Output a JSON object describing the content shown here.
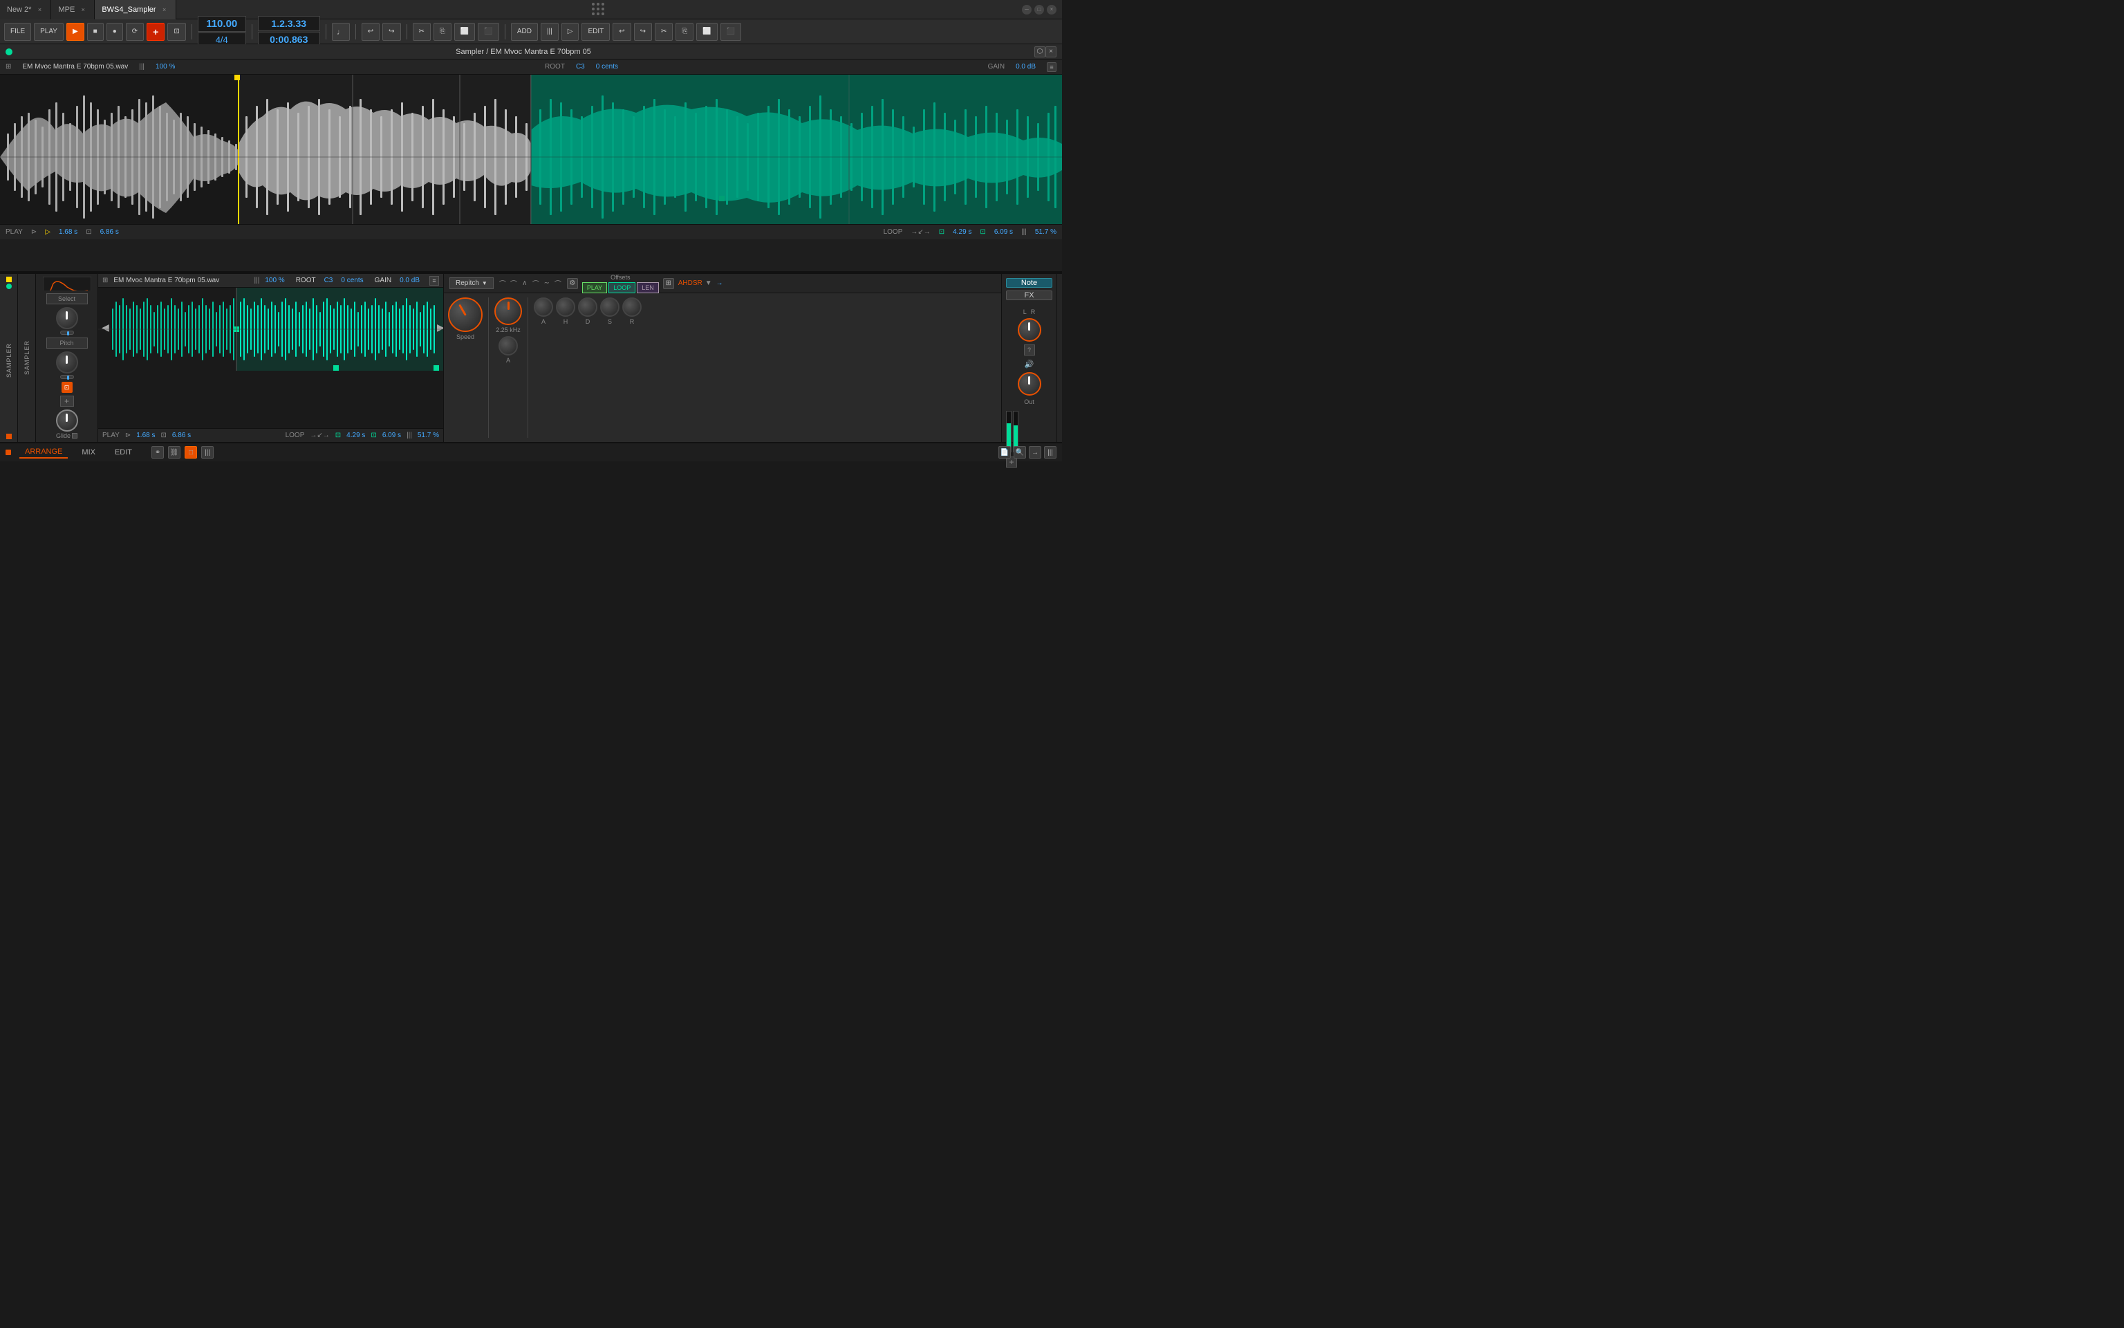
{
  "titlebar": {
    "tabs": [
      {
        "label": "New 2*",
        "active": false,
        "closeable": true
      },
      {
        "label": "MPE",
        "active": false,
        "closeable": true
      },
      {
        "label": "BWS4_Sampler",
        "active": true,
        "closeable": true
      }
    ],
    "title": "BWS4_Sampler"
  },
  "transport": {
    "file_label": "FILE",
    "play_label": "PLAY",
    "bpm": "110.00",
    "time_sig_top": "4",
    "time_sig_bottom": "4",
    "position": "1.2.3.33",
    "time": "0:00.863",
    "add_label": "ADD",
    "edit_label": "EDIT"
  },
  "sampler_window": {
    "title": "Sampler / EM Mvoc Mantra E 70bpm 05",
    "filename": "EM Mvoc Mantra E 70bpm 05.wav",
    "zoom_label": "100 %",
    "root_label": "ROOT",
    "root_note": "C3",
    "root_cents": "0 cents",
    "gain_label": "GAIN",
    "gain_value": "0.0 dB",
    "play_label": "PLAY",
    "play_time": "1.68 s",
    "total_time": "6.86 s",
    "loop_label": "LOOP",
    "loop_time": "4.29 s",
    "loop_end_time": "6.09 s",
    "loop_pct": "51.7 %"
  },
  "bottom_panel": {
    "filename": "EM Mvoc Mantra E 70bpm 05.wav",
    "zoom_label": "100 %",
    "root_label": "ROOT",
    "root_note": "C3",
    "root_cents": "0 cents",
    "gain_label": "GAIN",
    "gain_value": "0.0 dB",
    "play_label": "PLAY",
    "play_time": "1.68 s",
    "total_time": "6.86 s",
    "loop_label": "LOOP",
    "loop_time": "4.29 s",
    "loop_end_time": "6.09 s",
    "loop_pct": "51.7 %",
    "note_btn": "Note",
    "fx_btn": "FX",
    "out_label": "Out",
    "select_label": "Select",
    "pitch_label": "Pitch",
    "glide_label": "Glide",
    "repitch_label": "Repitch",
    "speed_label": "Speed",
    "offsets_label": "Offsets",
    "play_btn": "PLAY",
    "loop_btn": "LOOP",
    "len_btn": "LEN",
    "freq_label": "2.25 kHz",
    "attack_label": "A",
    "ahdsr_label": "AHDSR",
    "env_labels": [
      "A",
      "H",
      "D",
      "S",
      "R"
    ],
    "sampler_label": "SAMPLER",
    "ch_label": "SAMPLER"
  },
  "footer": {
    "arrange_label": "ARRANGE",
    "mix_label": "MIX",
    "edit_label": "EDIT",
    "active_tab": "ARRANGE"
  },
  "colors": {
    "orange": "#e85000",
    "teal": "#0d9e80",
    "teal_dark": "#0d6e5a",
    "blue_accent": "#4aaff0",
    "gold": "#ffd700",
    "green": "#00dd99"
  }
}
